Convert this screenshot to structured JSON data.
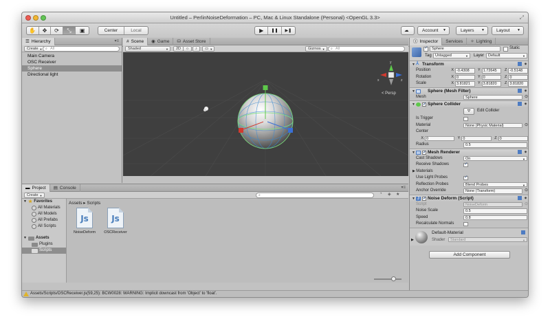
{
  "window": {
    "title": "Untitled – PerlinNoiseDeformation – PC, Mac & Linux Standalone (Personal) <OpenGL 3.3>"
  },
  "toolbar": {
    "tools": [
      "✋",
      "✥",
      "⟳",
      "⤡",
      "▣"
    ],
    "pivot": "Center",
    "handle": "Local",
    "play": "▶",
    "pause": "❚❚",
    "step": "▶❚",
    "account": "Account",
    "layers": "Layers",
    "layout": "Layout"
  },
  "hierarchy": {
    "tab": "Hierarchy",
    "create": "Create",
    "search_placeholder": "All",
    "items": [
      "Main Camera",
      "OSC Receiver",
      "Sphere",
      "Directional light"
    ]
  },
  "scene": {
    "tabs": [
      "Scene",
      "Game",
      "Asset Store"
    ],
    "shading": "Shaded",
    "mode_2d": "2D",
    "gizmos": "Gizmos",
    "search_placeholder": "All",
    "persp": "Persp",
    "axis_y": "y",
    "axis_x": "x",
    "axis_z": "z"
  },
  "project": {
    "tabs": [
      "Project",
      "Console"
    ],
    "create": "Create",
    "favorites_label": "Favorites",
    "favorites": [
      "All Materials",
      "All Models",
      "All Prefabs",
      "All Scripts"
    ],
    "assets_label": "Assets",
    "folders": [
      "Plugins",
      "Scripts"
    ],
    "breadcrumb": "Assets ▸ Scripts",
    "files": [
      {
        "name": "NoiseDeform",
        "glyph": "Js"
      },
      {
        "name": "OSCReceiver",
        "glyph": "Js"
      }
    ]
  },
  "status": {
    "message": "Assets/Scripts/OSCReceiver.js(59,25): BCW0028: WARNING: Implicit downcast from 'Object' to 'float'."
  },
  "inspector": {
    "tabs": [
      "Inspector",
      "Services",
      "Lighting"
    ],
    "object_name": "Sphere",
    "static_label": "Static",
    "tag_label": "Tag",
    "tag_value": "Untagged",
    "layer_label": "Layer",
    "layer_value": "Default",
    "transform": {
      "title": "Transform",
      "position_label": "Position",
      "position": [
        "-0.4308",
        "1.72645",
        "-0.5148"
      ],
      "rotation_label": "Rotation",
      "rotation": [
        "0",
        "0",
        "0"
      ],
      "scale_label": "Scale",
      "scale": [
        "3.81821",
        "3.81820",
        "3.81820"
      ]
    },
    "mesh_filter": {
      "title": "Sphere (Mesh Filter)",
      "mesh_label": "Mesh",
      "mesh_value": "Sphere"
    },
    "collider": {
      "title": "Sphere Collider",
      "edit_label": "Edit Collider",
      "is_trigger": "Is Trigger",
      "material_label": "Material",
      "material_value": "None (Physic Material)",
      "center_label": "Center",
      "center": [
        "0",
        "0",
        "0"
      ],
      "radius_label": "Radius",
      "radius_value": "0.5"
    },
    "renderer": {
      "title": "Mesh Renderer",
      "cast_shadows": "Cast Shadows",
      "cast_shadows_value": "On",
      "receive_shadows": "Receive Shadows",
      "materials": "Materials",
      "light_probes": "Use Light Probes",
      "reflection_probes": "Reflection Probes",
      "reflection_value": "Blend Probes",
      "anchor_override": "Anchor Override",
      "anchor_value": "None (Transform)"
    },
    "noise": {
      "title": "Noise Deform (Script)",
      "script_label": "Script",
      "script_value": "NoiseDeform",
      "scale_label": "Noise Scale",
      "scale_value": "0.5",
      "speed_label": "Speed",
      "speed_value": "0.8",
      "normals_label": "Recalculate Normals"
    },
    "material": {
      "name": "Default-Material",
      "shader_label": "Shader",
      "shader_value": "Standard"
    },
    "add_component": "Add Component"
  }
}
